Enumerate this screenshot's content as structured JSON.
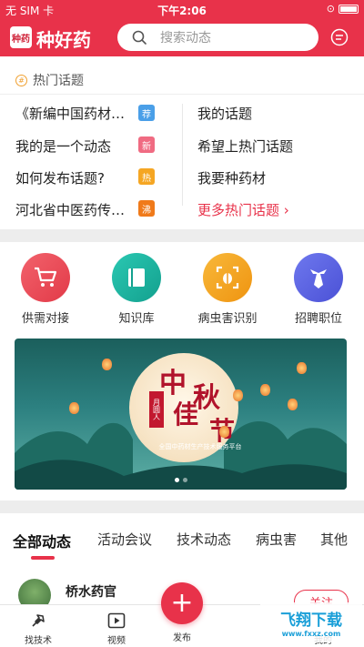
{
  "status": {
    "carrier": "无 SIM 卡",
    "time": "下午2:06"
  },
  "header": {
    "logo_mark": "种药",
    "title": "种好药",
    "search_placeholder": "搜索动态"
  },
  "topics": {
    "title": "热门话题",
    "left": [
      {
        "text": "《新编中国药材…",
        "tag": "荐",
        "tag_color": "#4a9fe8"
      },
      {
        "text": "我的是一个动态",
        "tag": "新",
        "tag_color": "#f06b82"
      },
      {
        "text": "如何发布话题?",
        "tag": "热",
        "tag_color": "#f5a623"
      },
      {
        "text": "河北省中医药传…",
        "tag": "沸",
        "tag_color": "#f07a1a"
      }
    ],
    "right": [
      "我的话题",
      "希望上热门话题",
      "我要种药材"
    ],
    "more": "更多热门话题 ›"
  },
  "features": [
    {
      "label": "供需对接",
      "icon": "cart-icon",
      "color": "#ef4b58"
    },
    {
      "label": "知识库",
      "icon": "book-icon",
      "color": "#19b3a0"
    },
    {
      "label": "病虫害识别",
      "icon": "bug-scan-icon",
      "color": "#f5a21b"
    },
    {
      "label": "招聘职位",
      "icon": "tie-icon",
      "color": "#5b63e0"
    }
  ],
  "banner": {
    "line1": "中",
    "line2": "秋",
    "line3": "佳",
    "line4": "节",
    "seal": "月圆人",
    "subtitle": "全国中药材生产技术服务平台"
  },
  "feed": {
    "tabs": [
      "全部动态",
      "活动会议",
      "技术动态",
      "病虫害",
      "其他"
    ],
    "user": "桥水药官",
    "follow": "关注"
  },
  "tabbar": {
    "items": [
      "找技术",
      "视频",
      "发布",
      "",
      "我的"
    ]
  },
  "watermark": {
    "title": "飞翔下载",
    "url": "www.fxxz.com"
  },
  "colors": {
    "brand": "#e8324a"
  }
}
